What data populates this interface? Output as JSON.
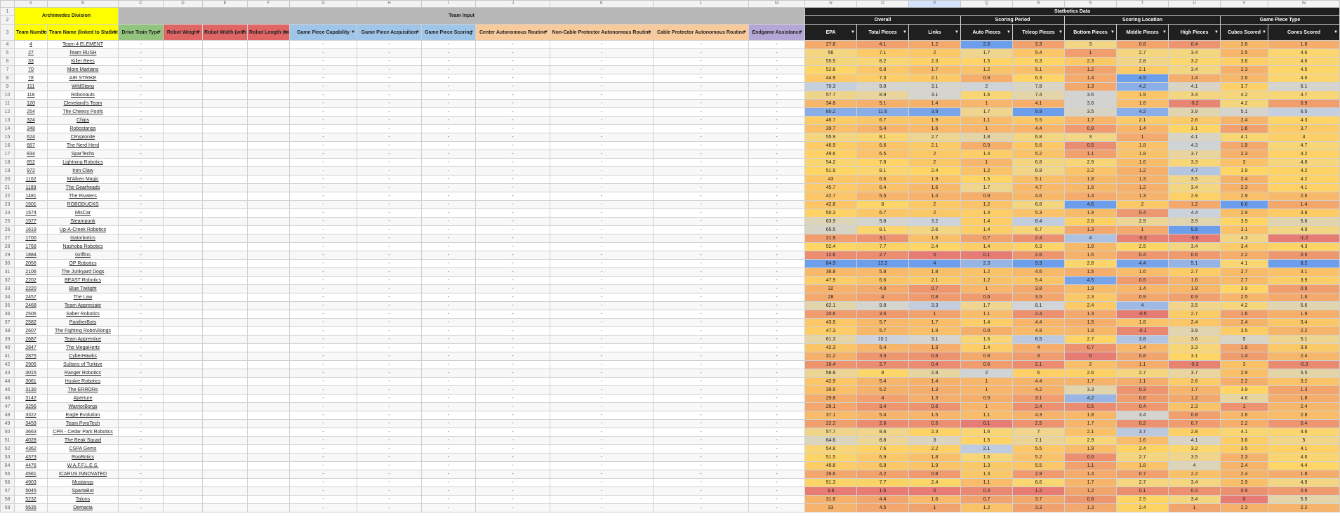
{
  "column_letters": [
    "",
    "A",
    "B",
    "C",
    "D",
    "E",
    "F",
    "G",
    "H",
    "I",
    "J",
    "K",
    "L",
    "M",
    "N",
    "O",
    "P",
    "Q",
    "R",
    "S",
    "T",
    "U",
    "V",
    "W"
  ],
  "selected_column": "P",
  "banners": {
    "division": "Archimedes Division",
    "team_input": "Team Input",
    "statbotics": "Statbotics Data"
  },
  "subgroups": [
    "Overall",
    "Scoring Period",
    "Scoring Location",
    "Game Piece Type"
  ],
  "headers": {
    "team_number": "Team Number (linked to FRC Events)",
    "team_name": "Team Name (linked to Statbotics)",
    "drive_train": "Drive Train Type",
    "robot_weight": "Robot Weight",
    "robot_width": "Robot Width (with Bumpers)",
    "robot_length": "Robot Length (with Bumpers)",
    "gp_capability": "Game Piece Capability",
    "gp_acquisition": "Game Piece Acquisition",
    "gp_scoring": "Game Piece Scoring",
    "center_auto": "Center Autonomous Routine",
    "noncable_auto": "Non-Cable Protector Autonomous Routine",
    "cable_auto": "Cable Protector Autonomous Routine",
    "endgame": "Endgame Assistance",
    "stats": [
      "EPA",
      "Total Pieces",
      "Links",
      "Auto Pieces",
      "Teleop Pieces",
      "Bottom Pieces",
      "Middle Pieces",
      "High Pieces",
      "Cubes Scored",
      "Cones Scored"
    ]
  },
  "dash": "-",
  "filter_icon": "▼",
  "teams": [
    {
      "row": 4,
      "num": "4",
      "name": "Team 4 ELEMENT",
      "stats": [
        "27.8",
        "4.1",
        "1.2",
        "2.5",
        "3.3",
        "3",
        "0.8",
        "0.4",
        "2.6",
        "1.8"
      ]
    },
    {
      "row": 5,
      "num": "27",
      "name": "Team RUSH",
      "stats": [
        "56",
        "7.1",
        "2",
        "1.7",
        "5.4",
        "1",
        "2.7",
        "3.4",
        "2.5",
        "4.6"
      ]
    },
    {
      "row": 6,
      "num": "33",
      "name": "Killer Bees",
      "stats": [
        "55.5",
        "8.2",
        "2.3",
        "1.5",
        "6.3",
        "2.3",
        "2.8",
        "3.2",
        "3.6",
        "4.6"
      ]
    },
    {
      "row": 7,
      "num": "70",
      "name": "More Martians",
      "stats": [
        "52.8",
        "6.8",
        "1.7",
        "1.2",
        "5.1",
        "1.2",
        "2.1",
        "3.4",
        "2.3",
        "4.5"
      ]
    },
    {
      "row": 8,
      "num": "78",
      "name": "AIR STRIKE",
      "stats": [
        "44.9",
        "7.3",
        "2.1",
        "0.9",
        "6.3",
        "1.4",
        "4.5",
        "1.4",
        "2.6",
        "4.6"
      ]
    },
    {
      "row": 9,
      "num": "111",
      "name": "WildStang",
      "stats": [
        "70.3",
        "9.8",
        "3.1",
        "2",
        "7.8",
        "1.3",
        "4.2",
        "4.1",
        "3.7",
        "6.1"
      ]
    },
    {
      "row": 10,
      "num": "118",
      "name": "Robonauts",
      "stats": [
        "57.7",
        "8.9",
        "3.1",
        "1.6",
        "7.4",
        "3.6",
        "1.9",
        "3.4",
        "4.2",
        "4.7"
      ]
    },
    {
      "row": 11,
      "num": "120",
      "name": "Cleveland's Team",
      "stats": [
        "34.8",
        "5.1",
        "1.4",
        "1",
        "4.1",
        "3.6",
        "1.6",
        "-0.2",
        "4.2",
        "0.9"
      ]
    },
    {
      "row": 12,
      "num": "254",
      "name": "The Cheesy Poofs",
      "stats": [
        "80.2",
        "11.6",
        "3.9",
        "1.7",
        "9.9",
        "3.5",
        "4.2",
        "3.9",
        "5.1",
        "6.5"
      ]
    },
    {
      "row": 13,
      "num": "324",
      "name": "Chips",
      "stats": [
        "46.7",
        "6.7",
        "1.9",
        "1.1",
        "5.5",
        "1.7",
        "2.1",
        "2.6",
        "2.4",
        "4.3"
      ]
    },
    {
      "row": 14,
      "num": "348",
      "name": "Robostangs",
      "stats": [
        "39.7",
        "5.4",
        "1.6",
        "1",
        "4.4",
        "0.9",
        "1.4",
        "3.1",
        "1.6",
        "3.7"
      ]
    },
    {
      "row": 15,
      "num": "624",
      "name": "CRyptonite",
      "stats": [
        "55.9",
        "8.1",
        "2.7",
        "1.8",
        "6.8",
        "3",
        "1",
        "4.1",
        "4.1",
        "4"
      ]
    },
    {
      "row": 16,
      "num": "687",
      "name": "The Nerd Herd",
      "stats": [
        "46.9",
        "6.6",
        "2.1",
        "0.9",
        "5.6",
        "0.5",
        "1.8",
        "4.3",
        "1.9",
        "4.7"
      ]
    },
    {
      "row": 17,
      "num": "834",
      "name": "SparTechs",
      "stats": [
        "49.6",
        "6.5",
        "2",
        "1.4",
        "5.2",
        "1.1",
        "1.8",
        "3.7",
        "2.3",
        "4.2"
      ]
    },
    {
      "row": 18,
      "num": "852",
      "name": "Lightning Robotics",
      "stats": [
        "54.2",
        "7.8",
        "2",
        "1",
        "6.8",
        "2.9",
        "1.6",
        "3.3",
        "3",
        "4.8"
      ]
    },
    {
      "row": 19,
      "num": "972",
      "name": "Iron Claw",
      "stats": [
        "51.9",
        "8.1",
        "2.4",
        "1.2",
        "6.9",
        "2.2",
        "1.2",
        "4.7",
        "3.9",
        "4.2"
      ]
    },
    {
      "row": 20,
      "num": "1102",
      "name": "M'Aiken Magic",
      "stats": [
        "43",
        "6.6",
        "1.9",
        "1.5",
        "5.1",
        "1.8",
        "1.3",
        "3.5",
        "2.4",
        "4.2"
      ]
    },
    {
      "row": 21,
      "num": "1189",
      "name": "The Gearheads",
      "stats": [
        "45.7",
        "6.4",
        "1.6",
        "1.7",
        "4.7",
        "1.8",
        "1.2",
        "3.4",
        "2.3",
        "4.1"
      ]
    },
    {
      "row": 22,
      "num": "1481",
      "name": "The Rivaters",
      "stats": [
        "42.7",
        "5.5",
        "1.4",
        "0.9",
        "4.6",
        "1.4",
        "1.3",
        "2.9",
        "2.9",
        "2.6"
      ]
    },
    {
      "row": 23,
      "num": "1501",
      "name": "ROBODUCKS",
      "stats": [
        "42.8",
        "8",
        "2",
        "1.2",
        "6.8",
        "4.6",
        "2",
        "1.2",
        "6.6",
        "1.4"
      ]
    },
    {
      "row": 24,
      "num": "1574",
      "name": "MisCar",
      "stats": [
        "50.3",
        "6.7",
        "2",
        "1.4",
        "5.3",
        "1.9",
        "0.4",
        "4.4",
        "2.9",
        "3.8"
      ]
    },
    {
      "row": 25,
      "num": "1577",
      "name": "Steampunk",
      "stats": [
        "63.9",
        "9.8",
        "3.2",
        "1.4",
        "8.4",
        "2.6",
        "2.9",
        "3.9",
        "3.9",
        "5.6"
      ]
    },
    {
      "row": 26,
      "num": "1619",
      "name": "Up-A-Creek Robotics",
      "stats": [
        "65.5",
        "8.1",
        "2.6",
        "1.4",
        "6.7",
        "1.3",
        "1",
        "5.6",
        "3.1",
        "4.9"
      ]
    },
    {
      "row": 27,
      "num": "1700",
      "name": "Gatorbotics",
      "stats": [
        "21.9",
        "3.1",
        "1.8",
        "0.7",
        "2.4",
        "4",
        "-0.3",
        "-0.6",
        "4.3",
        "-1.2"
      ]
    },
    {
      "row": 28,
      "num": "1768",
      "name": "Nashoba Robotics",
      "stats": [
        "52.4",
        "7.7",
        "2.4",
        "1.4",
        "6.3",
        "1.8",
        "2.5",
        "3.4",
        "3.4",
        "4.3"
      ]
    },
    {
      "row": 29,
      "num": "1884",
      "name": "Griffins",
      "stats": [
        "12.6",
        "2.7",
        "0",
        "0.1",
        "2.6",
        "1.6",
        "0.4",
        "0.6",
        "2.2",
        "0.5"
      ]
    },
    {
      "row": 30,
      "num": "2056",
      "name": "OP Robotics",
      "stats": [
        "84.9",
        "12.2",
        "4",
        "2.3",
        "9.9",
        "2.8",
        "4.4",
        "5.1",
        "4.1",
        "8.2"
      ]
    },
    {
      "row": 31,
      "num": "2106",
      "name": "The Junkyard Dogs",
      "stats": [
        "36.8",
        "5.8",
        "1.8",
        "1.2",
        "4.6",
        "1.5",
        "1.6",
        "2.7",
        "2.7",
        "3.1"
      ]
    },
    {
      "row": 32,
      "num": "2202",
      "name": "BEAST Robotics",
      "stats": [
        "47.9",
        "6.6",
        "2.1",
        "1.2",
        "5.4",
        "4.5",
        "0.5",
        "1.6",
        "2.7",
        "3.9"
      ]
    },
    {
      "row": 33,
      "num": "2220",
      "name": "Blue Twilight",
      "stats": [
        "32",
        "4.8",
        "0.7",
        "1",
        "3.8",
        "1.9",
        "1.4",
        "1.8",
        "3.9",
        "0.9"
      ]
    },
    {
      "row": 34,
      "num": "2457",
      "name": "The Law",
      "stats": [
        "28",
        "4",
        "0.8",
        "0.6",
        "3.5",
        "2.3",
        "0.9",
        "0.9",
        "2.5",
        "1.6"
      ]
    },
    {
      "row": 35,
      "num": "2468",
      "name": "Team Appreciate",
      "stats": [
        "62.1",
        "9.8",
        "3.3",
        "1.7",
        "8.1",
        "2.4",
        "4",
        "3.5",
        "4.2",
        "5.6"
      ]
    },
    {
      "row": 36,
      "num": "2506",
      "name": "Saber Robotics",
      "stats": [
        "20.6",
        "3.5",
        "1",
        "1.1",
        "2.4",
        "1.3",
        "-0.5",
        "2.7",
        "1.6",
        "1.9"
      ]
    },
    {
      "row": 37,
      "num": "2582",
      "name": "PantherBots",
      "stats": [
        "43.9",
        "5.7",
        "1.7",
        "1.4",
        "4.4",
        "1.5",
        "1.8",
        "2.4",
        "2.4",
        "3.4"
      ]
    },
    {
      "row": 38,
      "num": "2607",
      "name": "The Fighting RoboVikings",
      "stats": [
        "47.3",
        "5.7",
        "1.8",
        "0.9",
        "4.8",
        "1.8",
        "-0.1",
        "3.9",
        "3.5",
        "2.2"
      ]
    },
    {
      "row": 39,
      "num": "2687",
      "name": "Team Apprentice",
      "stats": [
        "61.3",
        "10.1",
        "3.1",
        "1.6",
        "8.5",
        "2.7",
        "3.8",
        "3.6",
        "5",
        "5.1"
      ]
    },
    {
      "row": 40,
      "num": "2847",
      "name": "The MegaHertz",
      "stats": [
        "42.3",
        "5.4",
        "1.3",
        "1.4",
        "4",
        "0.7",
        "1.4",
        "3.3",
        "1.8",
        "3.6"
      ]
    },
    {
      "row": 41,
      "num": "2875",
      "name": "CyberHawks",
      "stats": [
        "31.2",
        "3.3",
        "0.6",
        "0.8",
        "3",
        "0",
        "0.8",
        "3.1",
        "1.4",
        "2.4"
      ]
    },
    {
      "row": 42,
      "num": "2905",
      "name": "Sultans of Turkiye",
      "stats": [
        "16.4",
        "2.7",
        "0.4",
        "0.6",
        "2.1",
        "2",
        "1.1",
        "-0.3",
        "3",
        "-0.3"
      ]
    },
    {
      "row": 43,
      "num": "3015",
      "name": "Ranger Robotics",
      "stats": [
        "58.8",
        "8",
        "2.8",
        "2",
        "6",
        "2.6",
        "2.7",
        "3.7",
        "2.9",
        "5.5"
      ]
    },
    {
      "row": 44,
      "num": "3061",
      "name": "Huskie Robotics",
      "stats": [
        "42.9",
        "5.4",
        "1.4",
        "1",
        "4.4",
        "1.7",
        "1.1",
        "2.6",
        "2.2",
        "3.2"
      ]
    },
    {
      "row": 45,
      "num": "3130",
      "name": "The ERRORs",
      "stats": [
        "39.9",
        "5.2",
        "1.3",
        "1",
        "4.2",
        "3.3",
        "0.3",
        "1.7",
        "3.9",
        "1.3"
      ]
    },
    {
      "row": 46,
      "num": "3142",
      "name": "Aperture",
      "stats": [
        "29.8",
        "4",
        "1.3",
        "0.9",
        "3.1",
        "4.2",
        "0.6",
        "1.2",
        "4.6",
        "1.8"
      ]
    },
    {
      "row": 47,
      "num": "3256",
      "name": "WarriorBorgs",
      "stats": [
        "26.1",
        "3.4",
        "0.6",
        "1",
        "2.4",
        "0.5",
        "0.4",
        "2.3",
        "1",
        "2.4"
      ]
    },
    {
      "row": 48,
      "num": "3322",
      "name": "Eagle Evolution",
      "stats": [
        "37.1",
        "5.4",
        "1.5",
        "1.1",
        "4.3",
        "1.8",
        "3.4",
        "0.8",
        "2.6",
        "2.8"
      ]
    },
    {
      "row": 49,
      "num": "3459",
      "name": "Team PyroTech",
      "stats": [
        "22.2",
        "2.6",
        "0.5",
        "0.1",
        "2.5",
        "1.7",
        "0.2",
        "0.7",
        "2.2",
        "0.4"
      ]
    },
    {
      "row": 50,
      "num": "3663",
      "name": "CPR - Cedar Park Robotics",
      "stats": [
        "57.7",
        "8.6",
        "2.3",
        "1.6",
        "7",
        "2.1",
        "3.7",
        "2.8",
        "4.1",
        "4.6"
      ]
    },
    {
      "row": 51,
      "num": "4028",
      "name": "The Beak Squad",
      "stats": [
        "64.6",
        "8.8",
        "3",
        "1.5",
        "7.1",
        "2.9",
        "1.6",
        "4.1",
        "3.6",
        "5"
      ]
    },
    {
      "row": 52,
      "num": "4362",
      "name": "CSPA Gems",
      "stats": [
        "54.8",
        "7.6",
        "2.2",
        "2.1",
        "5.5",
        "1.9",
        "2.4",
        "3.2",
        "3.5",
        "4.1"
      ]
    },
    {
      "row": 53,
      "num": "4373",
      "name": "RooBotics",
      "stats": [
        "51.5",
        "6.9",
        "1.8",
        "1.6",
        "5.2",
        "0.6",
        "2.7",
        "3.5",
        "2.3",
        "4.6"
      ]
    },
    {
      "row": 54,
      "num": "4476",
      "name": "W.A.F.F.L.E.S.",
      "stats": [
        "46.8",
        "6.8",
        "1.9",
        "1.3",
        "5.5",
        "1.1",
        "1.8",
        "4",
        "2.4",
        "4.4"
      ]
    },
    {
      "row": 55,
      "num": "4561",
      "name": "ICARUS INNOVATED",
      "stats": [
        "26.6",
        "4.2",
        "0.8",
        "1.3",
        "2.9",
        "1.4",
        "0.7",
        "2.2",
        "2.4",
        "1.8"
      ]
    },
    {
      "row": 56,
      "num": "4903",
      "name": "Mustangs",
      "stats": [
        "51.3",
        "7.7",
        "2.4",
        "1.1",
        "6.6",
        "1.7",
        "2.7",
        "3.4",
        "2.9",
        "4.9"
      ]
    },
    {
      "row": 57,
      "num": "5045",
      "name": "SpartaBot",
      "stats": [
        "3.8",
        "1.5",
        "0",
        "0.3",
        "1.2",
        "1.2",
        "0.1",
        "0.2",
        "0.9",
        "0.6"
      ]
    },
    {
      "row": 58,
      "num": "5232",
      "name": "Talons",
      "stats": [
        "31.8",
        "4.4",
        "1.6",
        "0.7",
        "3.7",
        "0.8",
        "2.5",
        "3.4",
        "0",
        "5.5"
      ]
    },
    {
      "row": 59,
      "num": "5635",
      "name": "Demacia",
      "stats": [
        "33",
        "4.5",
        "1",
        "1.2",
        "3.3",
        "1.3",
        "2.4",
        "1",
        "2.3",
        "2.2"
      ]
    }
  ],
  "colors": {
    "red": "#e67c73",
    "orange": "#f6b26b",
    "yellow": "#ffd666",
    "grey": "#cfd4dc",
    "blue": "#6d9eeb"
  }
}
